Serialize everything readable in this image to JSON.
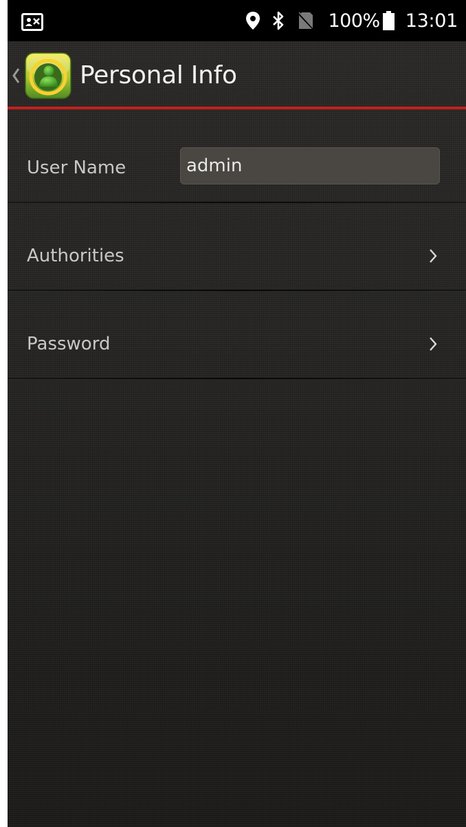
{
  "status_bar": {
    "battery_percent": "100%",
    "time": "13:01",
    "icons": [
      "contact-card-icon",
      "location-icon",
      "bluetooth-icon",
      "no-sim-icon",
      "battery-icon"
    ]
  },
  "header": {
    "title": "Personal Info",
    "accent_color": "#c4201c"
  },
  "form": {
    "username": {
      "label": "User Name",
      "value": "admin"
    },
    "authorities": {
      "label": "Authorities"
    },
    "password": {
      "label": "Password"
    }
  }
}
